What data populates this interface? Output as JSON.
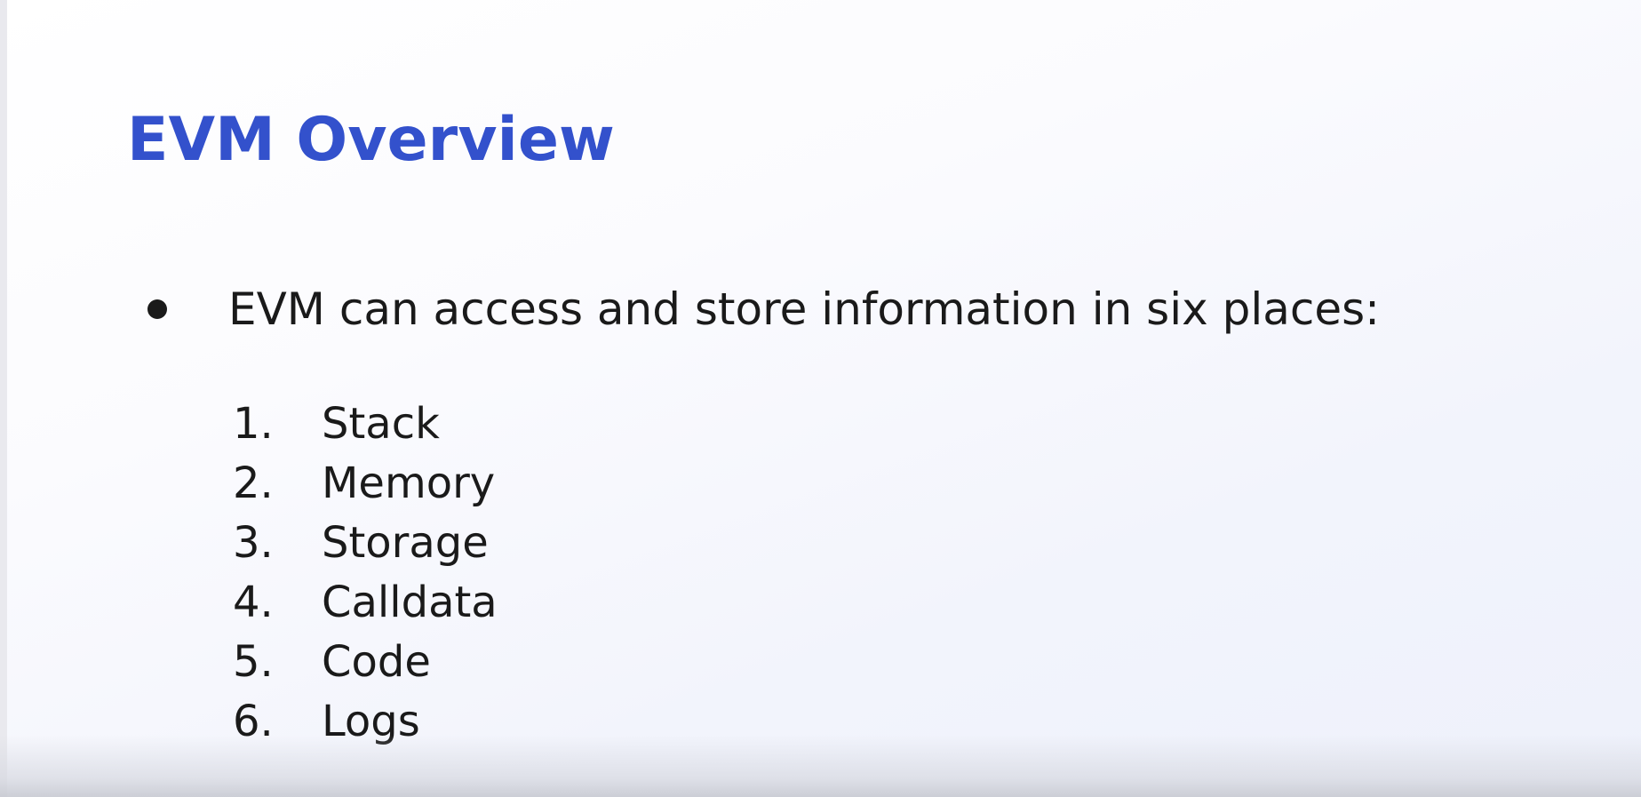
{
  "slide": {
    "title": "EVM Overview",
    "bullet": "EVM can access and store information in six places:",
    "places": [
      {
        "number": "1.",
        "label": "Stack"
      },
      {
        "number": "2.",
        "label": "Memory"
      },
      {
        "number": "3.",
        "label": "Storage"
      },
      {
        "number": "4.",
        "label": "Calldata"
      },
      {
        "number": "5.",
        "label": "Code"
      },
      {
        "number": "6.",
        "label": "Logs"
      }
    ]
  },
  "colors": {
    "title": "#3351cc",
    "text": "#1a1a1a"
  }
}
